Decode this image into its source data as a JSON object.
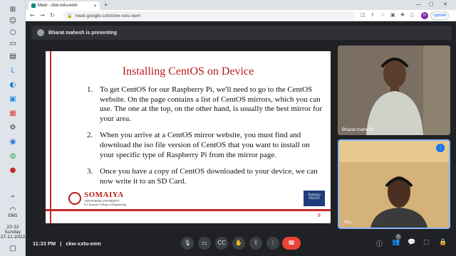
{
  "browser": {
    "tab_title": "Meet - ckw-xxtu-eem",
    "new_tab": "+",
    "url": "meet.google.com/ckw-xxtu-eem",
    "profile_initial": "N",
    "update_label": "Update"
  },
  "meet": {
    "presenting_text": "Bharat mahesh is presenting",
    "slide": {
      "title": "Installing CentOS on Device",
      "items": [
        {
          "num": "1.",
          "text": "To get CentOS for our Raspberry Pi, we'll need to go to the CentOS website. On the page contains a list of CentOS mirrors, which you can use. The one at the top, on the other hand, is usually the best mirror for your area."
        },
        {
          "num": "2.",
          "text": "When you arrive at a CentOS mirror website, you must find and download the iso file version of CentOS that you want to install on your specific type of Raspberry Pi from the mirror page."
        },
        {
          "num": "3.",
          "text": "Once you have a copy of CentOS downloaded to your device, we can now write it to an SD Card."
        }
      ],
      "logo_main": "SOMAIYA",
      "logo_sub": "VIDYAVIHAR UNIVERSITY",
      "logo_college": "K J Somaiya College of Engineering",
      "trust_text": "Somaiya TRUST",
      "page_number": "8"
    },
    "participants": [
      {
        "name": "Bharat mahesh"
      },
      {
        "name": "You"
      }
    ],
    "bottom": {
      "time": "11:33 PM",
      "meeting_code": "ckw-xxtu-eem",
      "people_count": "3"
    }
  },
  "taskbar": {
    "language": "ENG",
    "clock_time": "23:32",
    "clock_day": "Sunday",
    "clock_date": "27-11-2022"
  },
  "colors": {
    "slide_accent": "#c62828",
    "end_call": "#ea4335",
    "meet_bg": "#202124"
  }
}
